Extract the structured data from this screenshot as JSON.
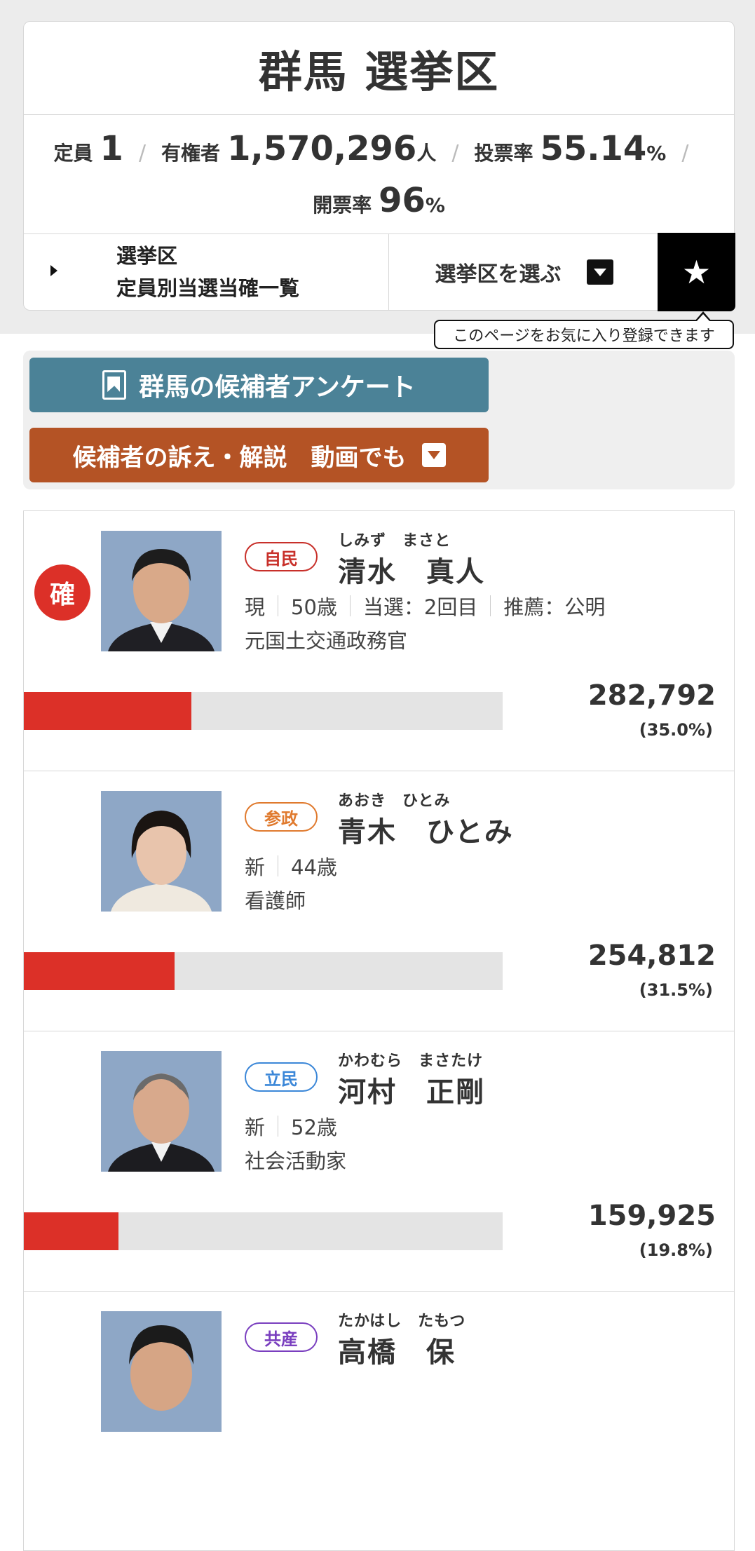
{
  "header": {
    "title": "群馬 選挙区",
    "teiin_label": "定員",
    "teiin_value": "1",
    "voters_label": "有権者",
    "voters_value": "1,570,296",
    "voters_unit": "人",
    "turnout_label": "投票率",
    "turnout_value": "55.14",
    "turnout_unit": "%",
    "count_label": "開票率",
    "count_value": "96",
    "count_unit": "%",
    "sep": "/"
  },
  "nav": {
    "list_line1": "選挙区",
    "list_line2": "定員別当選当確一覧",
    "select_label": "選挙区を選ぶ",
    "favorite_icon": "star-icon",
    "tooltip": "このページをお気に入り登録できます"
  },
  "actions": {
    "survey_label": "群馬の候補者アンケート",
    "video_label": "候補者の訴え・解説　動画でも"
  },
  "colors": {
    "accent_red": "#dc3028",
    "survey_btn": "#4b8297",
    "video_btn": "#b45325"
  },
  "candidates": [
    {
      "elected_badge": "確",
      "party": "自民",
      "party_color": "#c8302a",
      "kana": "しみず　まさと",
      "name": "清水　真人",
      "status": "現",
      "age": "50歳",
      "terms": "当選：2回目",
      "endorse": "推薦：公明",
      "job": "元国土交通政務官",
      "votes": "282,792",
      "percent": "(35.0%)",
      "share": 0.35
    },
    {
      "party": "参政",
      "party_color": "#e07a2e",
      "kana": "あおき　ひとみ",
      "name": "青木　ひとみ",
      "status": "新",
      "age": "44歳",
      "job": "看護師",
      "votes": "254,812",
      "percent": "(31.5%)",
      "share": 0.315
    },
    {
      "party": "立民",
      "party_color": "#3b87d8",
      "kana": "かわむら　まさたけ",
      "name": "河村　正剛",
      "status": "新",
      "age": "52歳",
      "job": "社会活動家",
      "votes": "159,925",
      "percent": "(19.8%)",
      "share": 0.198
    },
    {
      "party": "共産",
      "party_color": "#7a3fbf",
      "kana": "たかはし　たもつ",
      "name": "高橋　保"
    }
  ]
}
